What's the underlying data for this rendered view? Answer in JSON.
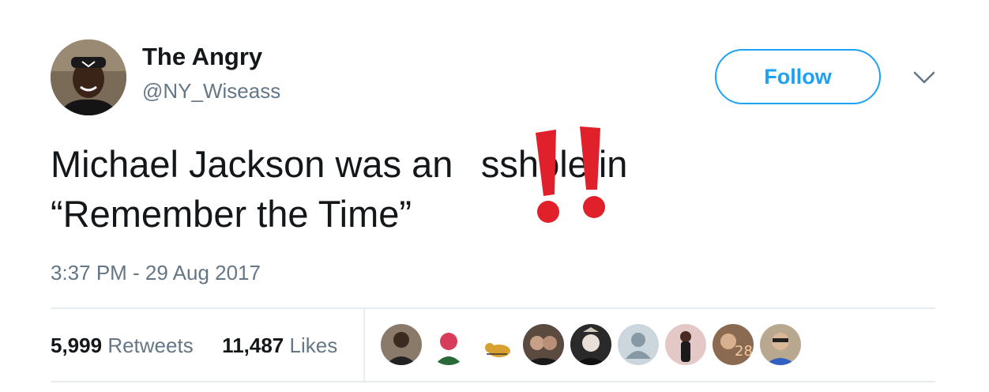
{
  "author": {
    "display_name": "The Angry",
    "handle": "@NY_Wiseass",
    "avatar_icon": "user-avatar-icon"
  },
  "actions": {
    "follow_label": "Follow",
    "more_icon": "chevron-down-icon"
  },
  "tweet": {
    "line1": "Michael Jackson was an   sshole in",
    "line2": "“Remember the Time”",
    "emoji": "double-exclamation-icon",
    "timestamp": "3:37 PM - 29 Aug 2017"
  },
  "stats": {
    "retweets_count": "5,999",
    "retweets_label": "Retweets",
    "likes_count": "11,487",
    "likes_label": "Likes"
  },
  "likers": [
    {
      "name": "liker-avatar-1",
      "color": "#8a7a6a"
    },
    {
      "name": "liker-avatar-2",
      "color": "#e8f0e4"
    },
    {
      "name": "liker-avatar-3",
      "color": "#f4f4f4"
    },
    {
      "name": "liker-avatar-4",
      "color": "#5a4a40"
    },
    {
      "name": "liker-avatar-5",
      "color": "#2a2a2a"
    },
    {
      "name": "liker-avatar-6",
      "color": "#ccd6dd"
    },
    {
      "name": "liker-avatar-7",
      "color": "#e4c8c8"
    },
    {
      "name": "liker-avatar-8",
      "color": "#8a6a50"
    },
    {
      "name": "liker-avatar-9",
      "color": "#b8a890"
    }
  ],
  "colors": {
    "accent": "#1da1f2",
    "secondary_text": "#657786",
    "emoji_red": "#e0202a"
  }
}
